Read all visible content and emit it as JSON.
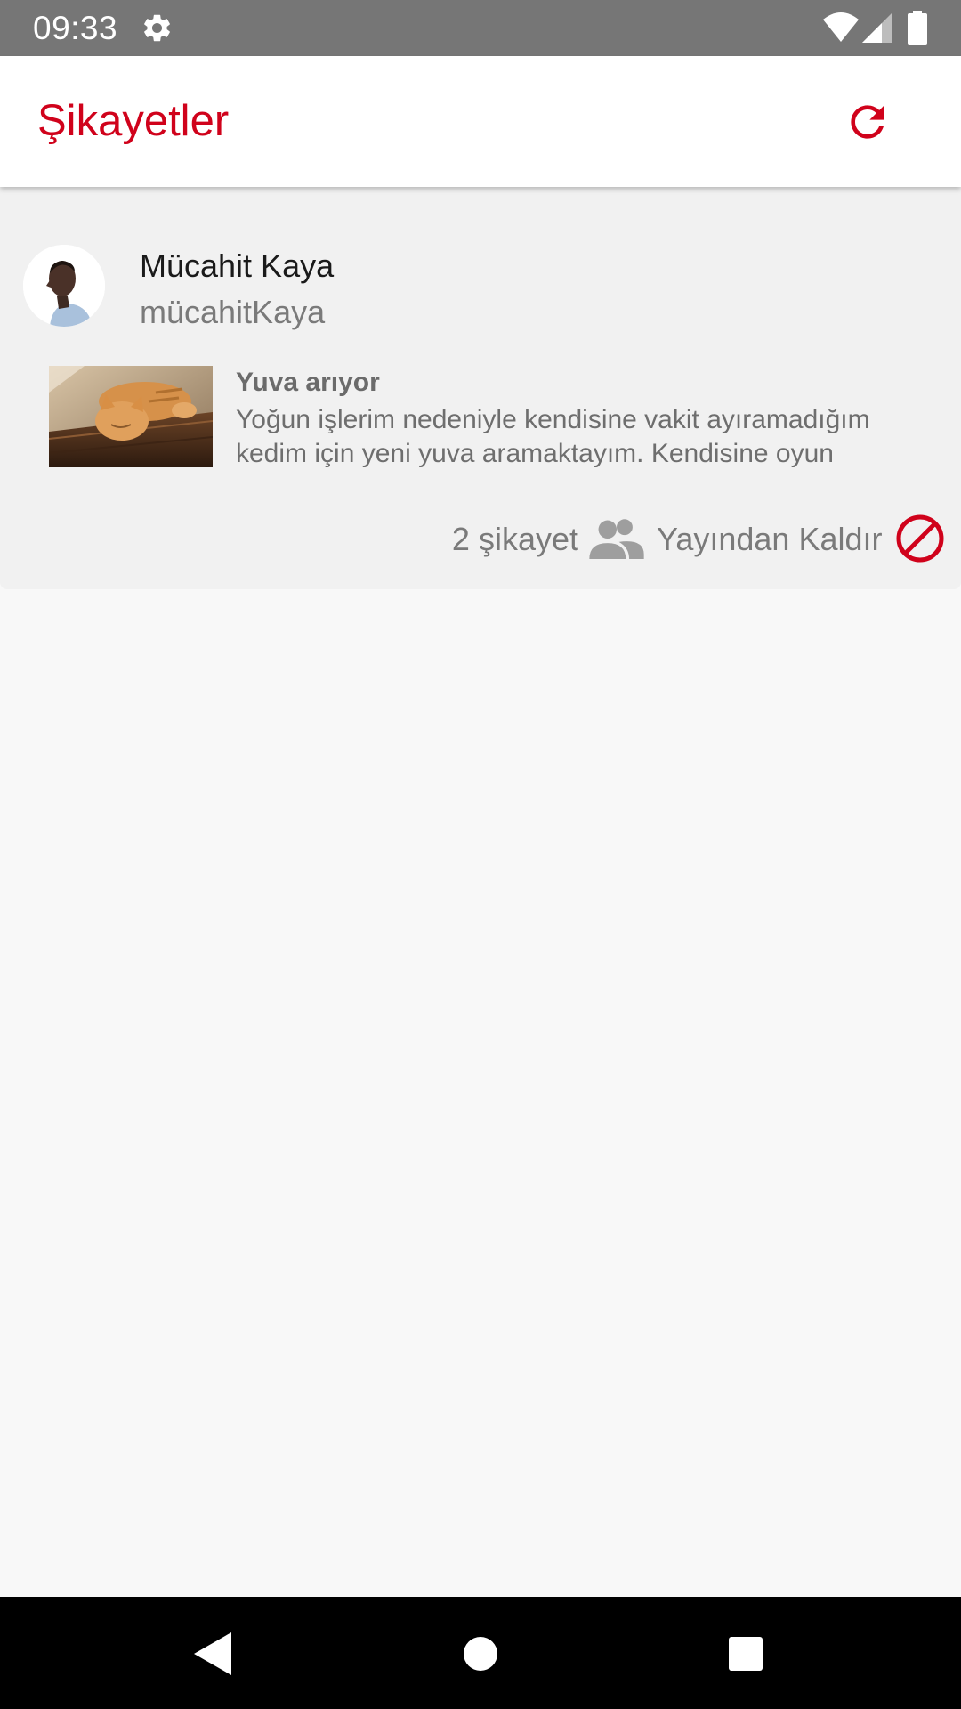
{
  "status_bar": {
    "time": "09:33",
    "icons": [
      "gear-icon",
      "wifi-icon",
      "signal-icon",
      "battery-icon"
    ]
  },
  "app_bar": {
    "title": "Şikayetler",
    "action_icon": "refresh-icon"
  },
  "complaint": {
    "user_name": "Mücahit Kaya",
    "user_handle": "mücahitKaya",
    "post_title": "Yuva arıyor",
    "post_description": "Yoğun işlerim nedeniyle kendisine vakit ayıramadığım kedim için yeni yuva aramaktayım. Kendisine oyun",
    "complaint_count": "2 şikayet",
    "unpublish_label": "Yayından Kaldır"
  },
  "nav_bar": {
    "icons": [
      "back-icon",
      "home-icon",
      "recents-icon"
    ]
  },
  "colors": {
    "accent": "#d0021b",
    "status_bar": "#767676",
    "card_background": "#f1f1f1",
    "page_background": "#f8f8f8"
  }
}
